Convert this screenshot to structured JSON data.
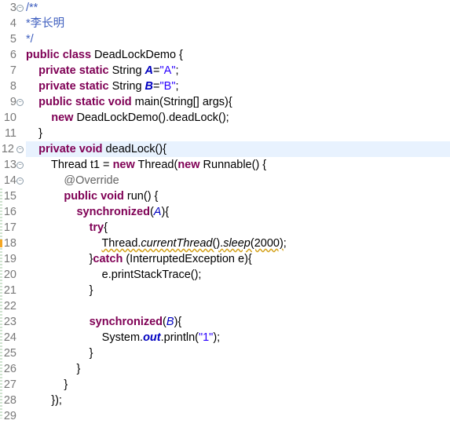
{
  "editor": {
    "colors": {
      "keyword": "#7f0055",
      "string": "#2a00ff",
      "comment": "#3f5fbf",
      "annotation": "#646464",
      "field": "#0000c0",
      "line_number": "#787878",
      "current_line": "#e8f2fe"
    },
    "lines": [
      {
        "n": "3",
        "tokens": [
          [
            "cm",
            "/**"
          ]
        ]
      },
      {
        "n": "4",
        "tokens": [
          [
            "cm",
            "*李长明"
          ]
        ]
      },
      {
        "n": "5",
        "tokens": [
          [
            "cm",
            "*/"
          ]
        ]
      },
      {
        "n": "6",
        "tokens": [
          [
            "kw",
            "public"
          ],
          [
            "t",
            " "
          ],
          [
            "kw",
            "class"
          ],
          [
            "t",
            " DeadLockDemo {"
          ]
        ]
      },
      {
        "n": "7",
        "tokens": [
          [
            "t",
            "    "
          ],
          [
            "kw",
            "private"
          ],
          [
            "t",
            " "
          ],
          [
            "kw",
            "static"
          ],
          [
            "t",
            " String "
          ],
          [
            "sfield",
            "A"
          ],
          [
            "t",
            "="
          ],
          [
            "str",
            "\"A\""
          ],
          [
            "t",
            ";"
          ]
        ]
      },
      {
        "n": "8",
        "tokens": [
          [
            "t",
            "    "
          ],
          [
            "kw",
            "private"
          ],
          [
            "t",
            " "
          ],
          [
            "kw",
            "static"
          ],
          [
            "t",
            " String "
          ],
          [
            "sfield",
            "B"
          ],
          [
            "t",
            "="
          ],
          [
            "str",
            "\"B\""
          ],
          [
            "t",
            ";"
          ]
        ]
      },
      {
        "n": "9",
        "tokens": [
          [
            "t",
            "    "
          ],
          [
            "kw",
            "public"
          ],
          [
            "t",
            " "
          ],
          [
            "kw",
            "static"
          ],
          [
            "t",
            " "
          ],
          [
            "kw",
            "void"
          ],
          [
            "t",
            " main(String[] args){"
          ]
        ]
      },
      {
        "n": "10",
        "tokens": [
          [
            "t",
            "        "
          ],
          [
            "kw",
            "new"
          ],
          [
            "t",
            " DeadLockDemo().deadLock();"
          ]
        ]
      },
      {
        "n": "11",
        "tokens": [
          [
            "t",
            "    }"
          ]
        ]
      },
      {
        "n": "12",
        "tokens": [
          [
            "t",
            "    "
          ],
          [
            "kw",
            "private"
          ],
          [
            "t",
            " "
          ],
          [
            "kw",
            "void"
          ],
          [
            "t",
            " deadLock(){"
          ]
        ]
      },
      {
        "n": "13",
        "tokens": [
          [
            "t",
            "        Thread t1 = "
          ],
          [
            "kw",
            "new"
          ],
          [
            "t",
            " Thread("
          ],
          [
            "kw",
            "new"
          ],
          [
            "t",
            " Runnable() {"
          ]
        ]
      },
      {
        "n": "14",
        "tokens": [
          [
            "t",
            "            "
          ],
          [
            "ann",
            "@Override"
          ]
        ]
      },
      {
        "n": "15",
        "tokens": [
          [
            "t",
            "            "
          ],
          [
            "kw",
            "public"
          ],
          [
            "t",
            " "
          ],
          [
            "kw",
            "void"
          ],
          [
            "t",
            " run() {"
          ]
        ]
      },
      {
        "n": "16",
        "tokens": [
          [
            "t",
            "                "
          ],
          [
            "kw",
            "synchronized"
          ],
          [
            "t",
            "("
          ],
          [
            "field",
            "A"
          ],
          [
            "t",
            "){"
          ]
        ]
      },
      {
        "n": "17",
        "tokens": [
          [
            "t",
            "                    "
          ],
          [
            "kw",
            "try"
          ],
          [
            "t",
            "{"
          ]
        ]
      },
      {
        "n": "18",
        "tokens": [
          [
            "t",
            "                        "
          ],
          [
            "warn",
            "Thread."
          ],
          [
            "warnsm",
            "currentThread"
          ],
          [
            "warn",
            "()."
          ],
          [
            "warnsm",
            "sleep"
          ],
          [
            "warn",
            "(2000)"
          ],
          [
            "t",
            ";"
          ]
        ]
      },
      {
        "n": "19",
        "tokens": [
          [
            "t",
            "                    }"
          ],
          [
            "kw",
            "catch"
          ],
          [
            "t",
            " (InterruptedException e){"
          ]
        ]
      },
      {
        "n": "20",
        "tokens": [
          [
            "t",
            "                        e.printStackTrace();"
          ]
        ]
      },
      {
        "n": "21",
        "tokens": [
          [
            "t",
            "                    }"
          ]
        ]
      },
      {
        "n": "22",
        "tokens": []
      },
      {
        "n": "23",
        "tokens": [
          [
            "t",
            "                    "
          ],
          [
            "kw",
            "synchronized"
          ],
          [
            "t",
            "("
          ],
          [
            "field",
            "B"
          ],
          [
            "t",
            "){"
          ]
        ]
      },
      {
        "n": "24",
        "tokens": [
          [
            "t",
            "                        System."
          ],
          [
            "sfield",
            "out"
          ],
          [
            "t",
            ".println("
          ],
          [
            "str",
            "\"1\""
          ],
          [
            "t",
            ");"
          ]
        ]
      },
      {
        "n": "25",
        "tokens": [
          [
            "t",
            "                    }"
          ]
        ]
      },
      {
        "n": "26",
        "tokens": [
          [
            "t",
            "                }"
          ]
        ]
      },
      {
        "n": "27",
        "tokens": [
          [
            "t",
            "            }"
          ]
        ]
      },
      {
        "n": "28",
        "tokens": [
          [
            "t",
            "        });"
          ]
        ]
      },
      {
        "n": "29",
        "tokens": []
      }
    ]
  }
}
